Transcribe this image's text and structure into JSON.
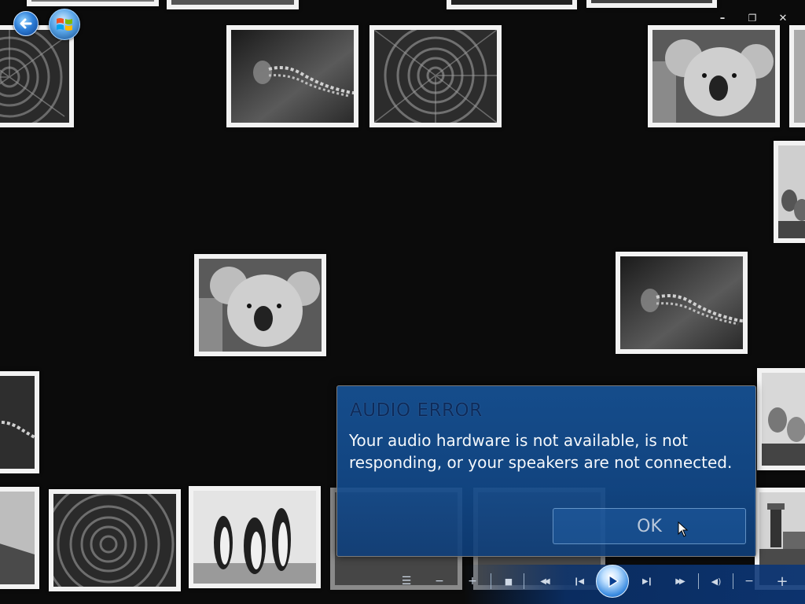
{
  "window": {
    "minimize_glyph": "–",
    "restore_glyph": "❐",
    "close_glyph": "✕"
  },
  "nav": {
    "back_icon": "back-arrow-icon",
    "start_icon": "windows-logo-icon"
  },
  "dialog": {
    "title": "AUDIO ERROR",
    "message": "Your audio hardware is not available, is not responding, or your speakers are not connected.",
    "ok_label": "OK"
  },
  "transport": {
    "playlist_glyph": "☰",
    "minus_glyph": "−",
    "plus_glyph": "+",
    "stop_glyph": "■",
    "rewind_glyph": "◀◀",
    "prev_glyph": "❙◀",
    "next_glyph": "▶❙",
    "ffwd_glyph": "▶▶",
    "volume_glyph": "◀)",
    "vol_minus_glyph": "−",
    "vol_plus_glyph": "+"
  },
  "colors": {
    "background": "#0b0b0b",
    "dialog_blue": "#164f92",
    "title_text": "#0e2b5a",
    "tile_border": "#f2f2f2"
  }
}
